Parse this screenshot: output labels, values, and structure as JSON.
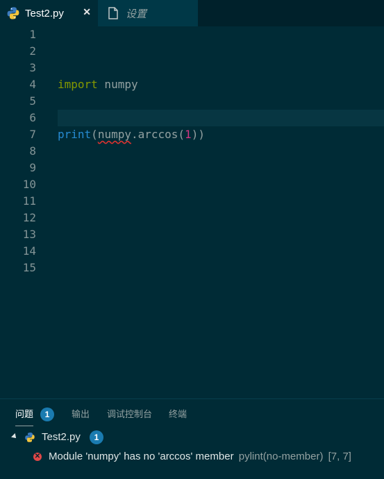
{
  "tabs": [
    {
      "label": "Test2.py",
      "icon": "python-icon",
      "active": true,
      "close": "✕"
    },
    {
      "label": "设置",
      "icon": "file-icon",
      "active": false
    }
  ],
  "editor": {
    "line_numbers": [
      "1",
      "2",
      "3",
      "4",
      "5",
      "6",
      "7",
      "8",
      "9",
      "10",
      "11",
      "12",
      "13",
      "14",
      "15"
    ],
    "current_line": 6,
    "code": {
      "line4": {
        "keyword": "import",
        "rest": " numpy"
      },
      "line7": {
        "fn": "print",
        "open": "(",
        "module": "numpy",
        "attr": ".arccos(",
        "arg": "1",
        "close": "))"
      }
    }
  },
  "panel": {
    "tabs": [
      {
        "label": "问题",
        "badge": "1",
        "active": true
      },
      {
        "label": "输出"
      },
      {
        "label": "调试控制台"
      },
      {
        "label": "终端"
      }
    ],
    "file_row": {
      "label": "Test2.py",
      "badge": "1"
    },
    "problem": {
      "message": "Module 'numpy' has no 'arccos' member",
      "source": "pylint(no-member)",
      "location": "[7, 7]"
    }
  },
  "colors": {
    "background": "#002b36",
    "tab_bar": "#00212b",
    "badge": "#1a7bb0",
    "error": "#e04848",
    "keyword_import": "#859900",
    "keyword_print": "#268bd2",
    "number": "#d33682"
  }
}
